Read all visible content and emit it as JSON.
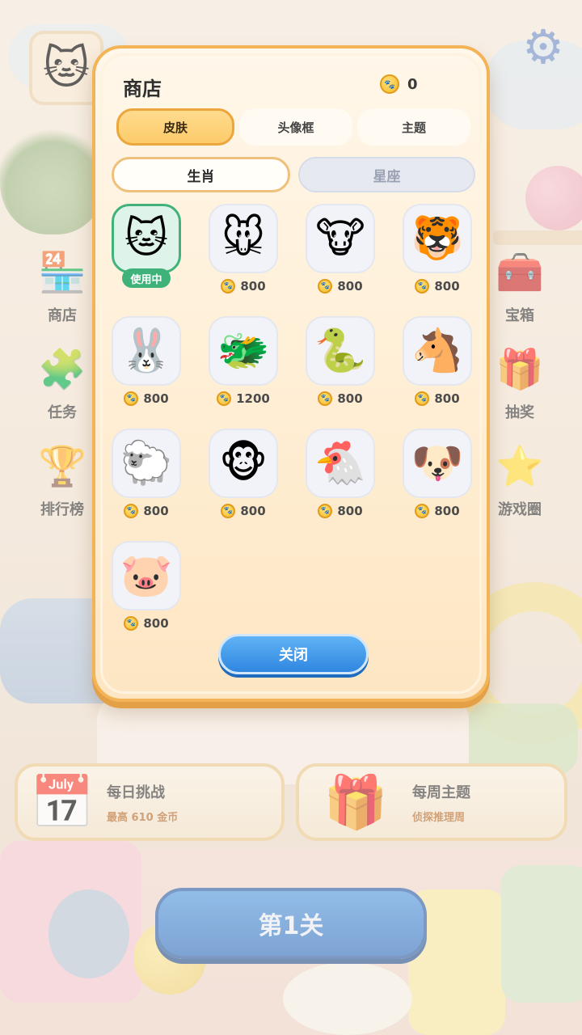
{
  "background": {
    "side_left": [
      {
        "label": "商店",
        "icon": "🏪",
        "name": "side-shop"
      },
      {
        "label": "任务",
        "icon": "🧩",
        "name": "side-tasks"
      },
      {
        "label": "排行榜",
        "icon": "🏆",
        "name": "side-leaderboard"
      }
    ],
    "side_right": [
      {
        "label": "宝箱",
        "icon": "🧰",
        "name": "side-chest"
      },
      {
        "label": "抽奖",
        "icon": "🎁",
        "name": "side-lottery"
      },
      {
        "label": "游戏圈",
        "icon": "⭐",
        "name": "side-game-circle"
      }
    ],
    "daily": {
      "title": "每日挑战",
      "sub": "最高 610 金币"
    },
    "weekly": {
      "title": "每周主题",
      "sub": "侦探推理周"
    },
    "level_button": "第1关"
  },
  "shop": {
    "title": "商店",
    "coins": "0",
    "tabs": [
      {
        "label": "皮肤",
        "active": true
      },
      {
        "label": "头像框",
        "active": false
      },
      {
        "label": "主题",
        "active": false
      }
    ],
    "subtabs": [
      {
        "label": "生肖",
        "active": true
      },
      {
        "label": "星座",
        "active": false
      }
    ],
    "in_use_label": "使用中",
    "items": [
      {
        "icon": "🐱",
        "price": "",
        "in_use": true
      },
      {
        "icon": "🐭",
        "price": "800"
      },
      {
        "icon": "🐮",
        "price": "800"
      },
      {
        "icon": "🐯",
        "price": "800"
      },
      {
        "icon": "🐰",
        "price": "800"
      },
      {
        "icon": "🐲",
        "price": "1200"
      },
      {
        "icon": "🐍",
        "price": "800"
      },
      {
        "icon": "🐴",
        "price": "800"
      },
      {
        "icon": "🐑",
        "price": "800"
      },
      {
        "icon": "🐵",
        "price": "800"
      },
      {
        "icon": "🐔",
        "price": "800"
      },
      {
        "icon": "🐶",
        "price": "800"
      },
      {
        "icon": "🐷",
        "price": "800"
      }
    ],
    "close_label": "关闭"
  },
  "colors": {
    "accent": "#f3b458",
    "selected_green": "#3fb27a",
    "button_blue": "#2f86e0"
  }
}
